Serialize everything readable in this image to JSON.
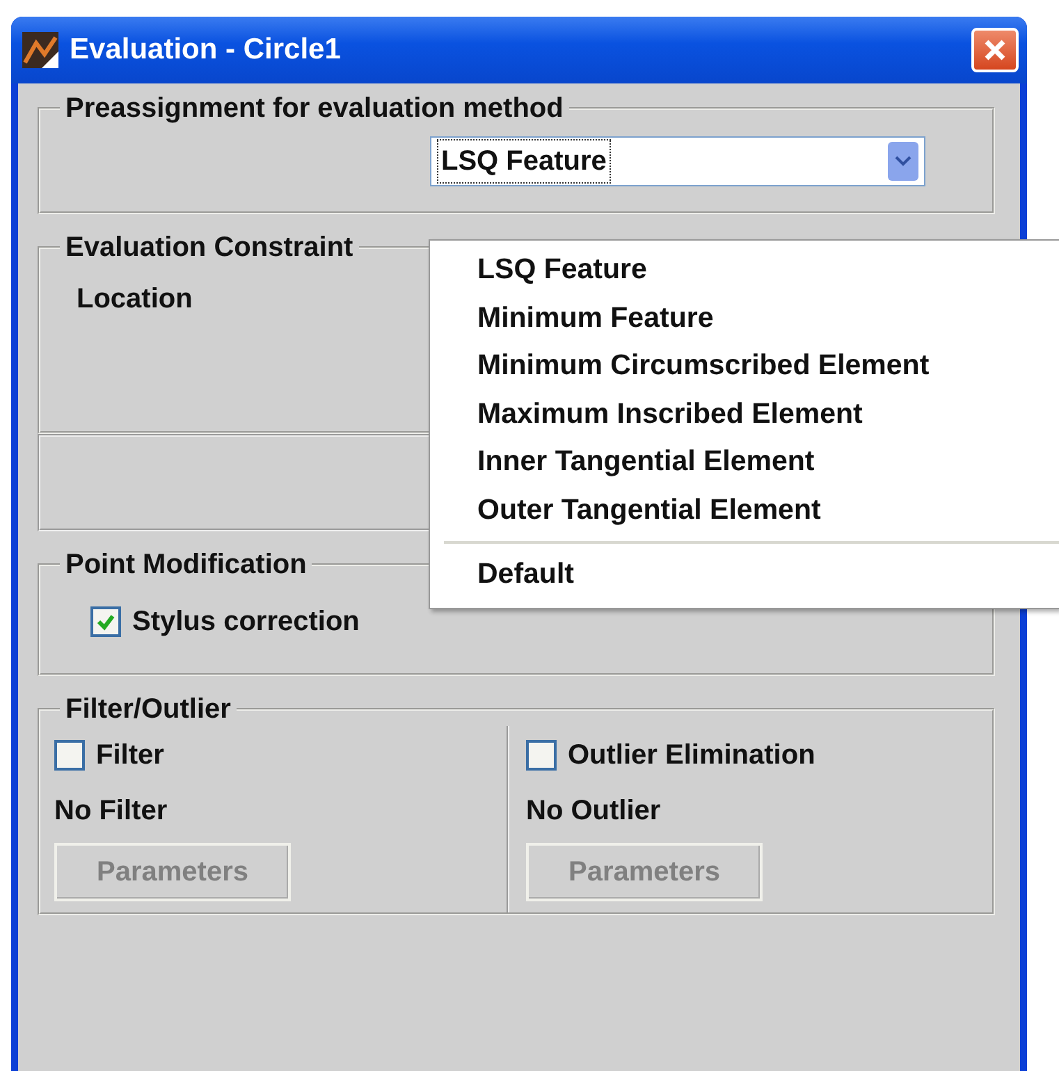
{
  "window": {
    "title": "Evaluation - Circle1"
  },
  "preassignment": {
    "title": "Preassignment for evaluation method",
    "dropdown": {
      "value": "LSQ Feature",
      "expanded": true,
      "options": [
        {
          "label": "LSQ Feature"
        },
        {
          "label": "Minimum Feature"
        },
        {
          "label": "Minimum Circumscribed Element"
        },
        {
          "label": "Maximum Inscribed Element"
        },
        {
          "label": "Inner Tangential Element"
        },
        {
          "label": "Outer Tangential Element"
        }
      ],
      "footer_option": "Default"
    }
  },
  "constraints": {
    "title": "Evaluation Constraint",
    "location_label": "Location"
  },
  "point_modification": {
    "title": "Point Modification",
    "stylus_correction": {
      "label": "Stylus correction",
      "checked": true
    }
  },
  "filter_outlier": {
    "title": "Filter/Outlier",
    "filter": {
      "label": "Filter",
      "checked": false,
      "status": "No Filter",
      "button": {
        "label": "Parameters",
        "disabled": true
      }
    },
    "outlier": {
      "label": "Outlier Elimination",
      "checked": false,
      "status": "No Outlier",
      "button": {
        "label": "Parameters",
        "disabled": true
      }
    }
  }
}
